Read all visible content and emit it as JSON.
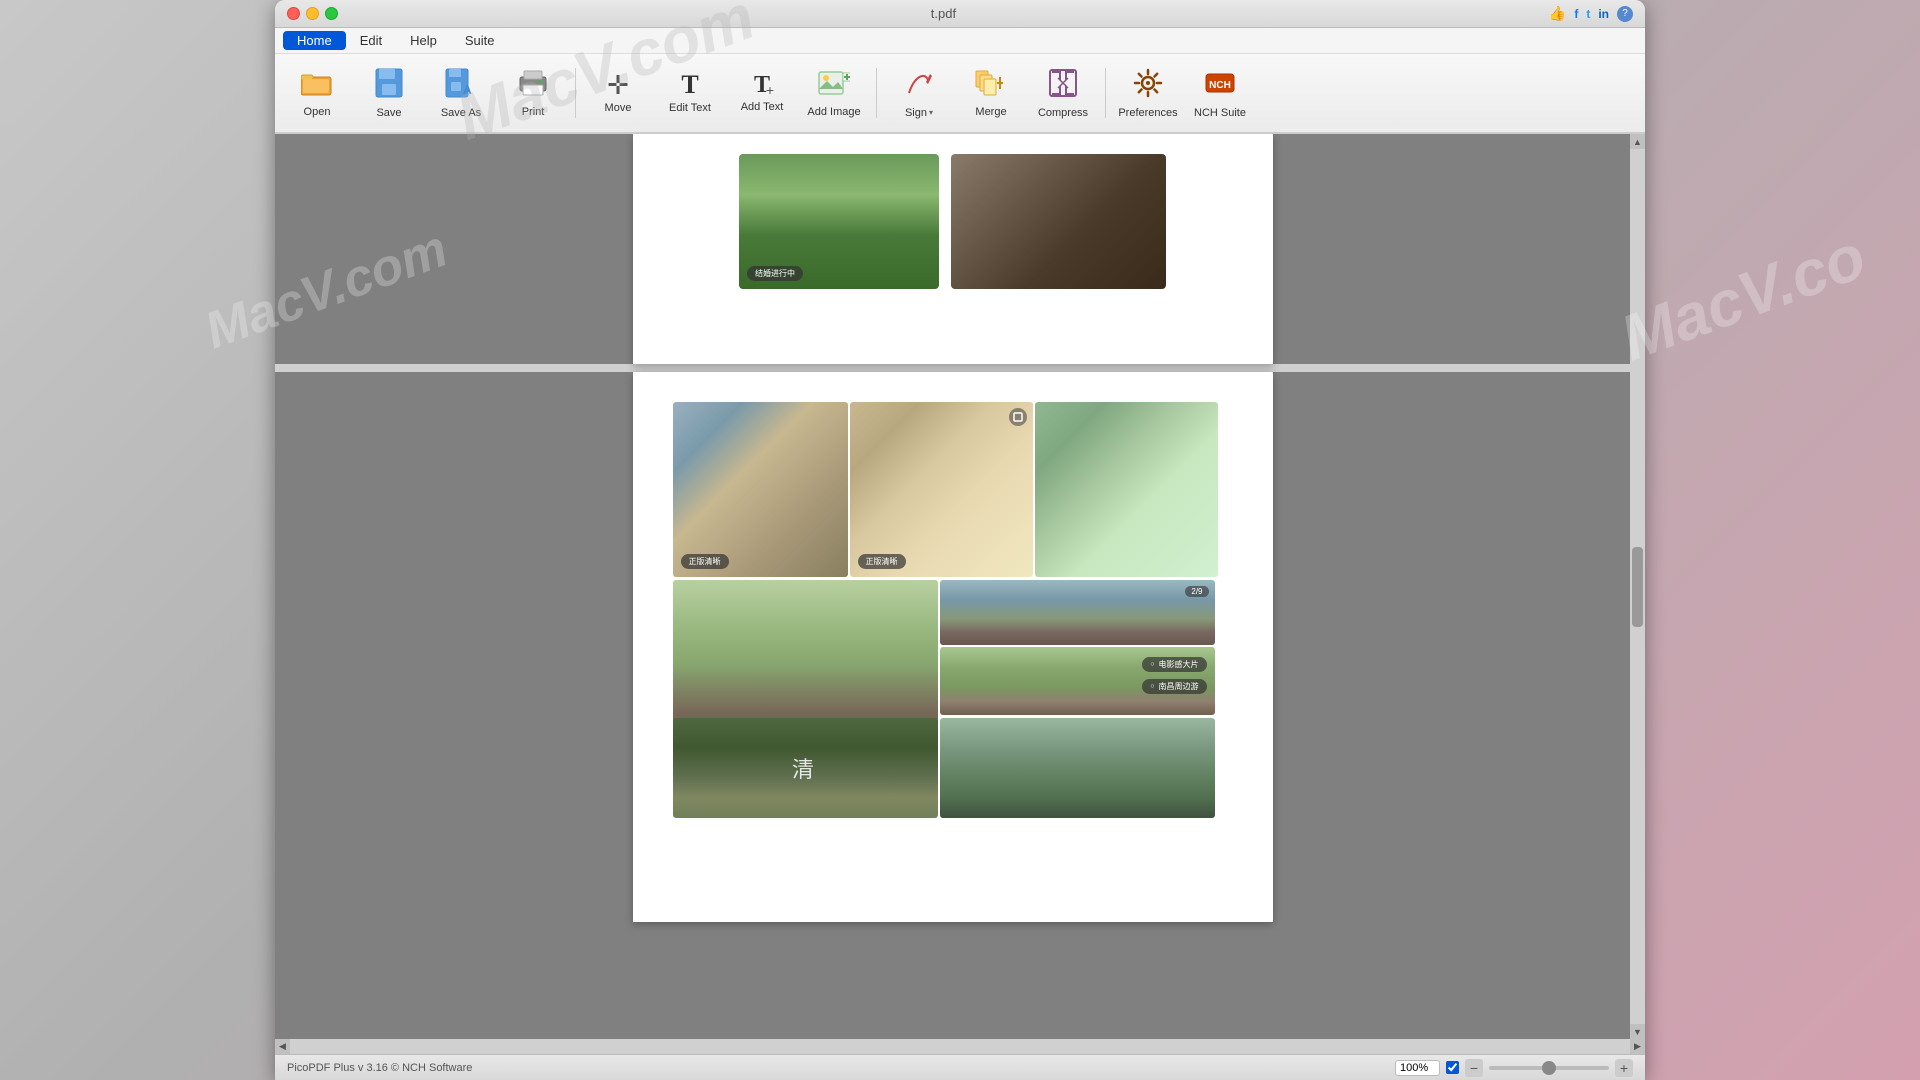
{
  "window": {
    "title": "t.pdf",
    "traffic_lights": [
      "close",
      "minimize",
      "maximize"
    ]
  },
  "watermarks": [
    {
      "text": "MacV.com",
      "class": "watermark-1"
    },
    {
      "text": "MacV.com",
      "class": "watermark-2"
    },
    {
      "text": "MacV.co",
      "class": "watermark-3"
    }
  ],
  "menu": {
    "items": [
      {
        "label": "Home",
        "active": true
      },
      {
        "label": "Edit",
        "active": false
      },
      {
        "label": "Help",
        "active": false
      },
      {
        "label": "Suite",
        "active": false
      }
    ]
  },
  "toolbar": {
    "buttons": [
      {
        "id": "open",
        "label": "Open",
        "icon": "📂"
      },
      {
        "id": "save",
        "label": "Save",
        "icon": "💾"
      },
      {
        "id": "saveas",
        "label": "Save As",
        "icon": "💾"
      },
      {
        "id": "print",
        "label": "Print",
        "icon": "🖨"
      },
      {
        "id": "move",
        "label": "Move",
        "icon": "✥"
      },
      {
        "id": "edittext",
        "label": "Edit Text",
        "icon": "T"
      },
      {
        "id": "addtext",
        "label": "Add Text",
        "icon": "T"
      },
      {
        "id": "addimage",
        "label": "Add Image",
        "icon": "🖼"
      },
      {
        "id": "sign",
        "label": "Sign",
        "icon": "✒"
      },
      {
        "id": "merge",
        "label": "Merge",
        "icon": "⊞"
      },
      {
        "id": "compress",
        "label": "Compress",
        "icon": "⊡"
      },
      {
        "id": "preferences",
        "label": "Preferences",
        "icon": "⚙"
      },
      {
        "id": "nchsuite",
        "label": "NCH Suite",
        "icon": "⬡"
      }
    ]
  },
  "status_bar": {
    "version": "PicoPDF Plus v 3.16 © NCH Software",
    "zoom_value": "100%",
    "zoom_placeholder": "100%"
  },
  "photos": {
    "page1": {
      "left_caption": "结婚进行中",
      "right_caption": ""
    },
    "page2": {
      "badge1": "正版清晰",
      "badge2": "正版清晰",
      "badge_num": "2/9",
      "tag1": "电影感大片",
      "tag2": "南昌周边游"
    }
  },
  "scroll": {
    "up_arrow": "▲",
    "down_arrow": "▼",
    "left_arrow": "◀",
    "right_arrow": "▶"
  }
}
